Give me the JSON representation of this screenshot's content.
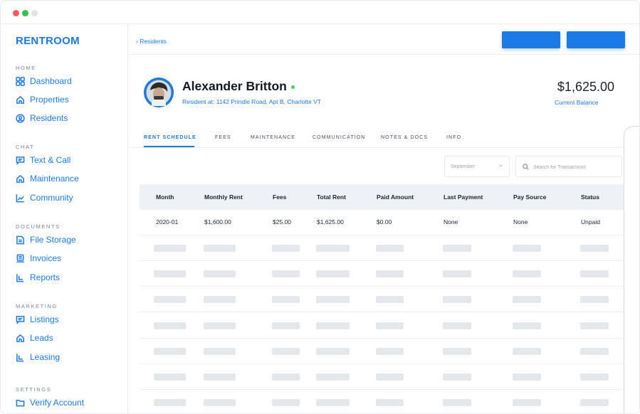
{
  "window": {
    "controls": [
      "close",
      "maximize",
      "minimize"
    ]
  },
  "sidebar": {
    "brand": "RENTROOM",
    "sections": [
      {
        "title": "HOME",
        "items": [
          {
            "label": "Dashboard",
            "icon": "dashboard-icon"
          },
          {
            "label": "Properties",
            "icon": "home-icon"
          },
          {
            "label": "Residents",
            "icon": "user-icon"
          }
        ]
      },
      {
        "title": "CHAT",
        "items": [
          {
            "label": "Text & Call",
            "icon": "chat-icon"
          },
          {
            "label": "Maintenance",
            "icon": "home-icon"
          },
          {
            "label": "Community",
            "icon": "chart-icon"
          }
        ]
      },
      {
        "title": "DOCUMENTS",
        "items": [
          {
            "label": "File Storage",
            "icon": "file-icon"
          },
          {
            "label": "Invoices",
            "icon": "invoice-icon"
          },
          {
            "label": "Reports",
            "icon": "report-icon"
          }
        ]
      },
      {
        "title": "MARKETING",
        "items": [
          {
            "label": "Listings",
            "icon": "chat-icon"
          },
          {
            "label": "Leads",
            "icon": "home-icon"
          },
          {
            "label": "Leasing",
            "icon": "report-icon"
          }
        ]
      },
      {
        "title": "SETTINGS",
        "items": [
          {
            "label": "Verify Account",
            "icon": "folder-icon"
          }
        ]
      }
    ]
  },
  "header": {
    "breadcrumb": "‹ Residents"
  },
  "resident": {
    "name": "Alexander Britton",
    "address": "Resident at: 1142 Prindle Road, Apt B, Charlotte VT",
    "balance": "$1,625.00",
    "balance_label": "Current Balance"
  },
  "tabs": [
    "RENT SCHEDULE",
    "FEES",
    "MAINTENANCE",
    "COMMUNICATION",
    "NOTES & DOCS",
    "INFO"
  ],
  "filters": {
    "month": "September",
    "search_placeholder": "Search for Transactions"
  },
  "table": {
    "columns": [
      "Month",
      "Monthly Rent",
      "Fees",
      "Total Rent",
      "Paid Amount",
      "Last Payment",
      "Pay Source",
      "Status"
    ],
    "rows": [
      [
        "2020-01",
        "$1,600.00",
        "$25.00",
        "$1,625.00",
        "$0.00",
        "None",
        "None",
        "Unpaid"
      ]
    ],
    "placeholder_rows": 7
  },
  "colors": {
    "accent": "#1b7ae6",
    "online": "#3ddc4e",
    "header_bg": "#eef1f5",
    "skeleton": "#e4e8ed"
  }
}
